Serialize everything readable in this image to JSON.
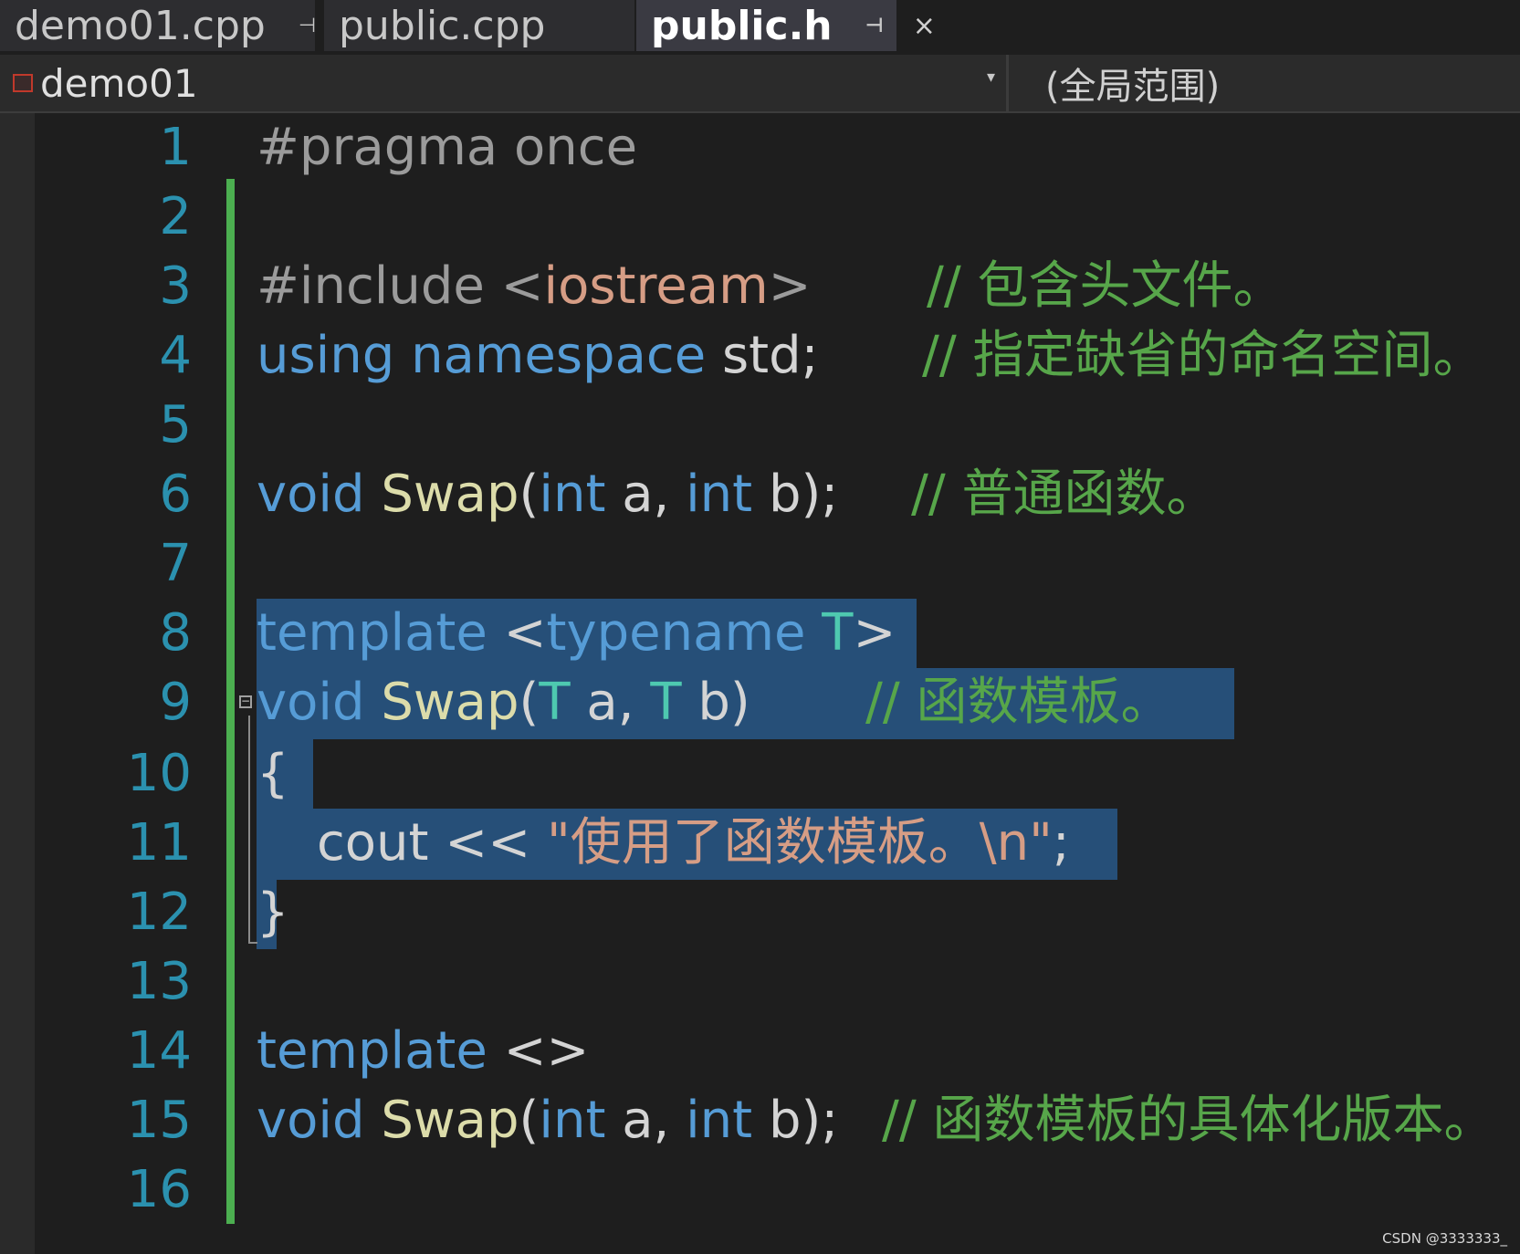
{
  "tabs": [
    {
      "label": "demo01.cpp",
      "pin": "⊣"
    },
    {
      "label": "public.cpp"
    },
    {
      "label": "public.h",
      "pin": "⊣",
      "close": "×"
    }
  ],
  "navbar": {
    "project": "demo01",
    "dropdown_arrow": "▾",
    "scope": "(全局范围)"
  },
  "editor": {
    "lines": [
      {
        "n": "1"
      },
      {
        "n": "2"
      },
      {
        "n": "3"
      },
      {
        "n": "4"
      },
      {
        "n": "5"
      },
      {
        "n": "6"
      },
      {
        "n": "7"
      },
      {
        "n": "8"
      },
      {
        "n": "9"
      },
      {
        "n": "10"
      },
      {
        "n": "11"
      },
      {
        "n": "12"
      },
      {
        "n": "13"
      },
      {
        "n": "14"
      },
      {
        "n": "15"
      },
      {
        "n": "16"
      }
    ],
    "code": {
      "l1": "#pragma once",
      "l3_a": "#include <",
      "l3_b": "iostream",
      "l3_c": ">",
      "l3_cmt": "// 包含头文件。",
      "l4_a": "using namespace",
      "l4_b": " std;",
      "l4_cmt": "// 指定缺省的命名空间。",
      "l6_a": "void",
      "l6_b": " Swap",
      "l6_c": "(",
      "l6_d": "int",
      "l6_e": " a, ",
      "l6_f": "int",
      "l6_g": " b);",
      "l6_cmt": "// 普通函数。",
      "l8_a": "template",
      "l8_b": " <",
      "l8_c": "typename",
      "l8_d": " T",
      "l8_e": ">",
      "l9_a": "void",
      "l9_b": " Swap",
      "l9_c": "(",
      "l9_d": "T",
      "l9_e": " a, ",
      "l9_f": "T",
      "l9_g": " b)",
      "l9_cmt": "// 函数模板。",
      "l10": "{",
      "l11_a": "cout",
      "l11_b": " << ",
      "l11_c": "\"使用了函数模板。\\n\"",
      "l11_d": ";",
      "l12": "}",
      "l14_a": "template",
      "l14_b": " <>",
      "l15_a": "void",
      "l15_b": " Swap",
      "l15_c": "(",
      "l15_d": "int",
      "l15_e": " a, ",
      "l15_f": "int",
      "l15_g": " b);",
      "l15_cmt": "// 函数模板的具体化版本。"
    },
    "colors": {
      "keyword": "#569cd6",
      "type": "#4ec9b0",
      "function": "#dcdcaa",
      "string": "#d69d85",
      "comment": "#57a64a",
      "line_number": "#2b91af",
      "selection": "#264f78"
    }
  },
  "watermark": "CSDN @3333333_"
}
